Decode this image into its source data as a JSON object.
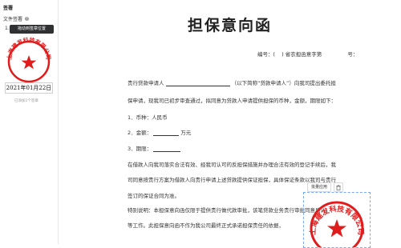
{
  "sidebar": {
    "title": "签署",
    "file_seal_label": "文件签署",
    "help_icon": "?",
    "item_number": "1.",
    "tooltip": "拖动到签章位置",
    "seal_text": "上海建发科技有限公司",
    "seal_color": "#e01c1c",
    "date_value": "2021年01月22日",
    "used_count": "已添加1个签章"
  },
  "document": {
    "title": "担保意向函",
    "number_label": "编号：(",
    "number_mid": ") 省农担函意字第",
    "number_suffix": "号：",
    "line1_a": "贵行贷款申请人",
    "line1_b": "（以下简称“贷款申请人”）向我司提出委托担",
    "line2": "保申请，现我司已初步审查通过，拟同意为贷款人申请提供担保的币种，金额，期限如下：",
    "item1": "1．币种：人民币",
    "item2_a": "2．金额：",
    "item2_b": "万元",
    "item3": "3．期限：",
    "para2_l1": "在借款人向我司落实合法有效、经我司认可的反担保措施并办理合法有效的登记手续后，我",
    "para2_l2": "司同意按贵行方案为借款人向贵行申请上述贷款提供保证担保，具体保证条款以我司与贵行",
    "para2_l3": "签订的保证合同为准。",
    "note_l1": "特别说明：本担保意向函仅限于提供贵行做代款审批，该笔贷款业务贵行审批同意后，",
    "note_l2": "等工作。此担保意向函不作为我公司最终正式承诺担保责任的依据，",
    "stamp_toolbar_label": "批量应用"
  }
}
